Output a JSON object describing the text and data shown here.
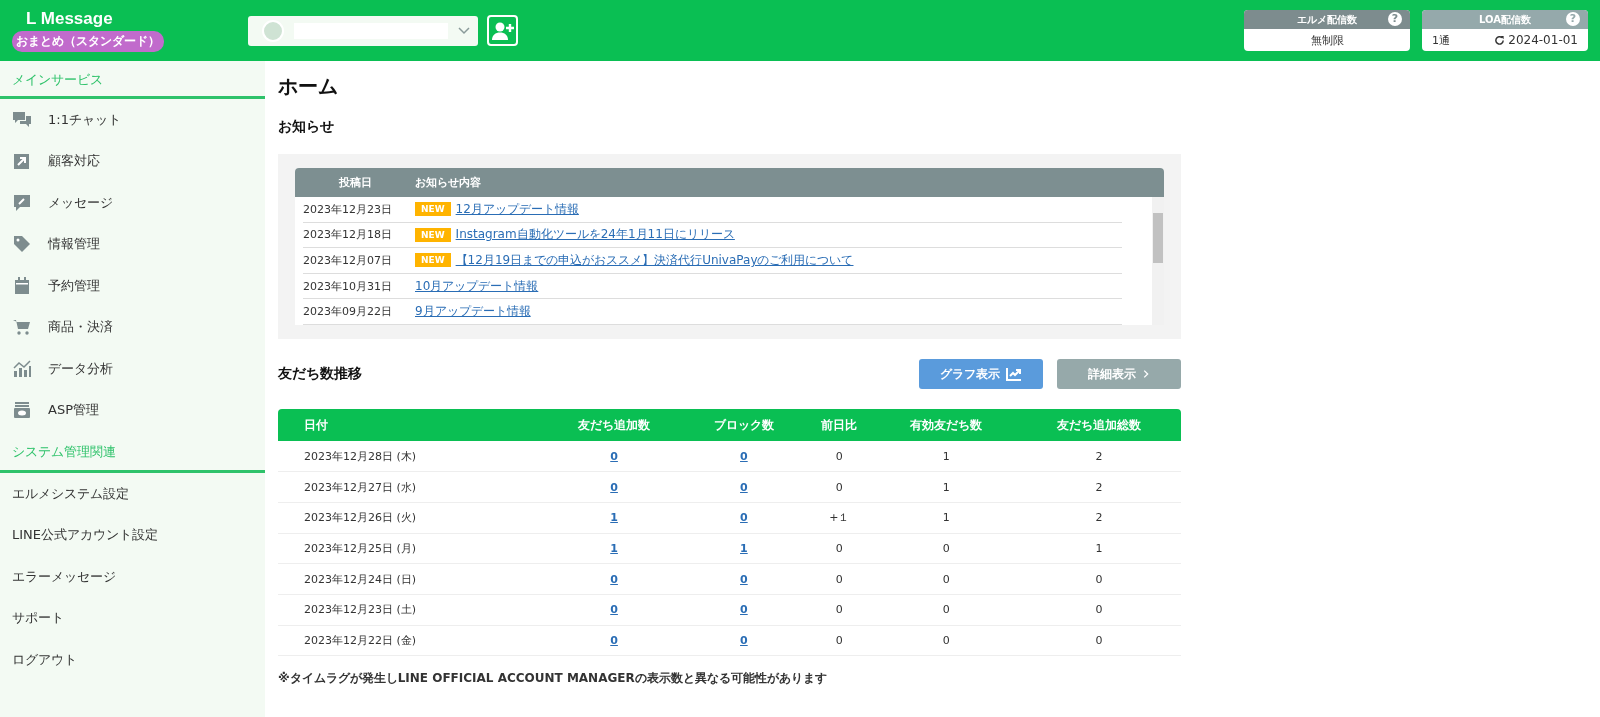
{
  "header": {
    "logo": "L Message",
    "plan": "おまとめ（スタンダード）",
    "account": {
      "kind": "dropdown"
    },
    "counters": [
      {
        "title": "エルメ配信数",
        "help": "?",
        "value": "無制限"
      },
      {
        "title": "LOA配信数",
        "help": "?",
        "value": "1通",
        "reset": "2024-01-01"
      }
    ]
  },
  "sidebar": [
    {
      "title": "メインサービス",
      "items": [
        {
          "label": "1:1チャット",
          "kind": "icon"
        },
        {
          "label": "顧客対応",
          "kind": "icon"
        },
        {
          "label": "メッセージ",
          "kind": "icon"
        },
        {
          "label": "情報管理",
          "kind": "icon"
        },
        {
          "label": "予約管理",
          "kind": "icon"
        },
        {
          "label": "商品・決済",
          "kind": "icon"
        },
        {
          "label": "データ分析",
          "kind": "icon"
        },
        {
          "label": "ASP管理",
          "kind": "icon"
        }
      ]
    },
    {
      "title": "システム管理関連",
      "items": [
        {
          "label": "エルメシステム設定",
          "kind": "plain"
        },
        {
          "label": "LINE公式アカウント設定",
          "kind": "plain"
        },
        {
          "label": "エラーメッセージ",
          "kind": "plain"
        },
        {
          "label": "サポート",
          "kind": "plain"
        },
        {
          "label": "ログアウト",
          "kind": "plain"
        }
      ]
    }
  ],
  "page_title": "ホーム",
  "notices": {
    "title": "お知らせ",
    "columns": [
      "投稿日",
      "お知らせ内容"
    ],
    "rows": [
      {
        "date": "2023年12月23日",
        "new": true,
        "badge": "NEW",
        "title": "12月アップデート情報"
      },
      {
        "date": "2023年12月18日",
        "new": true,
        "badge": "NEW",
        "title": "Instagram自動化ツールを24年1月11日にリリース"
      },
      {
        "date": "2023年12月07日",
        "new": true,
        "badge": "NEW",
        "title": "【12月19日までの申込がおススメ】決済代行UnivaPayのご利用について"
      },
      {
        "date": "2023年10月31日",
        "new": false,
        "title": "10月アップデート情報"
      },
      {
        "date": "2023年09月22日",
        "new": false,
        "title": "9月アップデート情報"
      }
    ]
  },
  "friends": {
    "title": "友だち数推移",
    "buttons": [
      {
        "label": "グラフ表示",
        "kind": "graph"
      },
      {
        "label": "詳細表示",
        "kind": "detail"
      }
    ],
    "columns": [
      "日付",
      "友だち追加数",
      "ブロック数",
      "前日比",
      "有効友だち数",
      "友だち追加総数"
    ],
    "rows": [
      [
        "2023年12月28日 (木)",
        "0",
        "0",
        "0",
        "1",
        "2"
      ],
      [
        "2023年12月27日 (水)",
        "0",
        "0",
        "0",
        "1",
        "2"
      ],
      [
        "2023年12月26日 (火)",
        "1",
        "0",
        "+１",
        "1",
        "2"
      ],
      [
        "2023年12月25日 (月)",
        "1",
        "1",
        "0",
        "0",
        "1"
      ],
      [
        "2023年12月24日 (日)",
        "0",
        "0",
        "0",
        "0",
        "0"
      ],
      [
        "2023年12月23日 (土)",
        "0",
        "0",
        "0",
        "0",
        "0"
      ],
      [
        "2023年12月22日 (金)",
        "0",
        "0",
        "0",
        "0",
        "0"
      ]
    ],
    "note": "※タイムラグが発生しLINE OFFICIAL ACCOUNT MANAGERの表示数と異なる可能性があります"
  }
}
